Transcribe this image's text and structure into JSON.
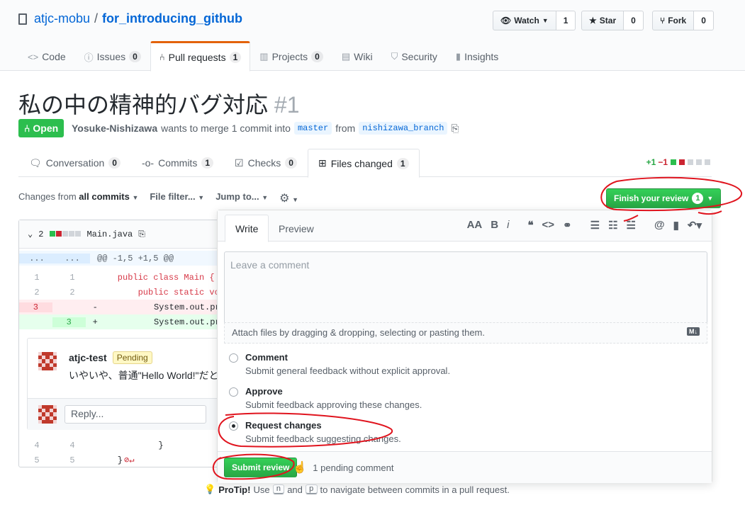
{
  "repo": {
    "owner": "atjc-mobu",
    "separator": "/",
    "name": "for_introducing_github",
    "watch_label": "Watch",
    "watch_count": "1",
    "star_label": "Star",
    "star_count": "0",
    "fork_label": "Fork",
    "fork_count": "0"
  },
  "nav": [
    {
      "label": "Code",
      "count": null,
      "icon": "code-icon"
    },
    {
      "label": "Issues",
      "count": "0",
      "icon": "issue-icon"
    },
    {
      "label": "Pull requests",
      "count": "1",
      "icon": "pull-request-icon"
    },
    {
      "label": "Projects",
      "count": "0",
      "icon": "project-icon"
    },
    {
      "label": "Wiki",
      "count": null,
      "icon": "book-icon"
    },
    {
      "label": "Security",
      "count": null,
      "icon": "shield-icon"
    },
    {
      "label": "Insights",
      "count": null,
      "icon": "graph-icon"
    }
  ],
  "pr": {
    "title": "私の中の精神的バグ対応",
    "number": "#1",
    "state": "Open",
    "author": "Yosuke-Nishizawa",
    "meta_text": "wants to merge 1 commit into",
    "base_branch": "master",
    "from_text": "from",
    "head_branch": "nishizawa_branch"
  },
  "pr_tabs": [
    {
      "label": "Conversation",
      "count": "0"
    },
    {
      "label": "Commits",
      "count": "1"
    },
    {
      "label": "Checks",
      "count": "0"
    },
    {
      "label": "Files changed",
      "count": "1"
    }
  ],
  "diffstat": {
    "additions": "+1",
    "deletions": "−1"
  },
  "toolbar": {
    "changes_from": "Changes from",
    "changes_value": "all commits",
    "file_filter": "File filter...",
    "jump_to": "Jump to..."
  },
  "finish_review": {
    "label": "Finish your review",
    "count": "1"
  },
  "file": {
    "changes": "2",
    "name": "Main.java",
    "hunk_header": "@@ -1,5 +1,5 @@",
    "hunk_dots": "...",
    "lines": [
      {
        "old": "1",
        "new": "1",
        "code": "    public class Main {"
      },
      {
        "old": "2",
        "new": "2",
        "code": "        public static void"
      },
      {
        "old": "3",
        "new": "",
        "code": "-           System.out.prin"
      },
      {
        "old": "",
        "new": "3",
        "code": "+           System.out.prin"
      },
      {
        "old": "4",
        "new": "4",
        "code": "            }"
      },
      {
        "old": "5",
        "new": "5",
        "code": "    }"
      }
    ]
  },
  "comment": {
    "author": "atjc-test",
    "badge": "Pending",
    "body": "いやいや、普通\"Hello World!\"だと",
    "reply_placeholder": "Reply..."
  },
  "review": {
    "tab_write": "Write",
    "tab_preview": "Preview",
    "placeholder": "Leave a comment",
    "attach_hint": "Attach files by dragging & dropping, selecting or pasting them.",
    "md_badge": "M↓",
    "options": [
      {
        "title": "Comment",
        "desc": "Submit general feedback without explicit approval.",
        "selected": false
      },
      {
        "title": "Approve",
        "desc": "Submit feedback approving these changes.",
        "selected": false
      },
      {
        "title": "Request changes",
        "desc": "Submit feedback suggesting changes.",
        "selected": true
      }
    ],
    "submit_label": "Submit review",
    "pending_text": "1 pending comment"
  },
  "protip": {
    "label": "ProTip!",
    "text1": "Use",
    "key1": "n",
    "and": "and",
    "key2": "p",
    "text2": "to navigate between commits in a pull request."
  },
  "colors": {
    "accent_green": "#2cbe4e",
    "link_blue": "#0366d6",
    "annotation_red": "#e0141e",
    "tab_orange": "#e36209"
  }
}
